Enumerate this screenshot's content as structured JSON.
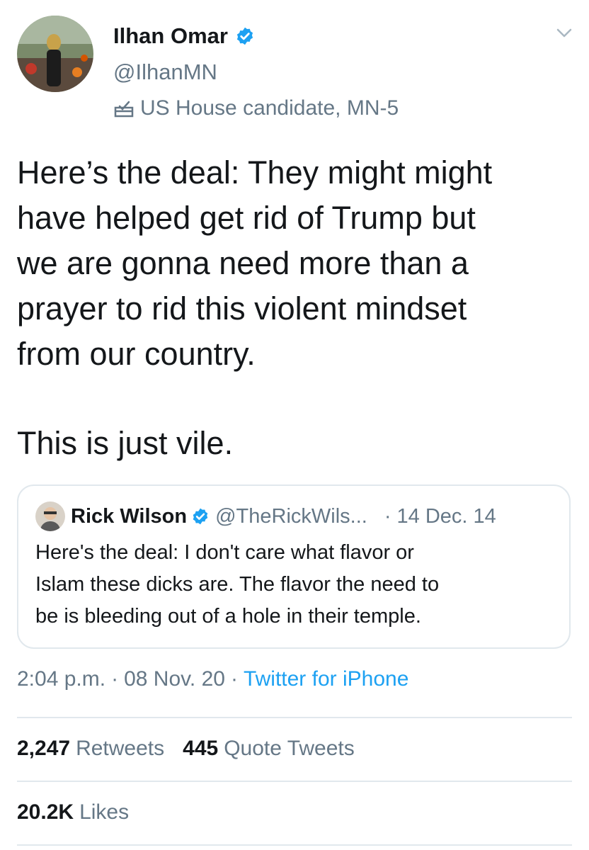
{
  "author": {
    "name": "Ilhan Omar",
    "handle": "@IlhanMN",
    "label": "US House candidate, MN-5"
  },
  "tweet": {
    "text": "Here’s the deal: They might might\nhave helped get rid of Trump but\nwe are gonna need more than a\nprayer to rid this violent mindset\nfrom our country.",
    "text_tail": "This is just vile."
  },
  "quoted": {
    "name": "Rick Wilson",
    "handle": "@TheRickWils...",
    "date": "14 Dec. 14",
    "text": "Here's the deal: I don't care what flavor or\nIslam these dicks are. The flavor the need to\nbe is bleeding out of a hole in their temple."
  },
  "meta": {
    "time": "2:04 p.m.",
    "date": "08 Nov. 20",
    "source": "Twitter for iPhone"
  },
  "stats": {
    "retweets_count": "2,247",
    "retweets_label": "Retweets",
    "quotes_count": "445",
    "quotes_label": "Quote Tweets",
    "likes_count": "20.2K",
    "likes_label": "Likes"
  },
  "colors": {
    "link": "#1da1f2",
    "secondary": "#657786",
    "divider": "#e1e8ed"
  },
  "icons": {
    "verified": "verified-badge-icon",
    "ballot": "ballot-box-icon",
    "chevron": "chevron-down-icon"
  }
}
